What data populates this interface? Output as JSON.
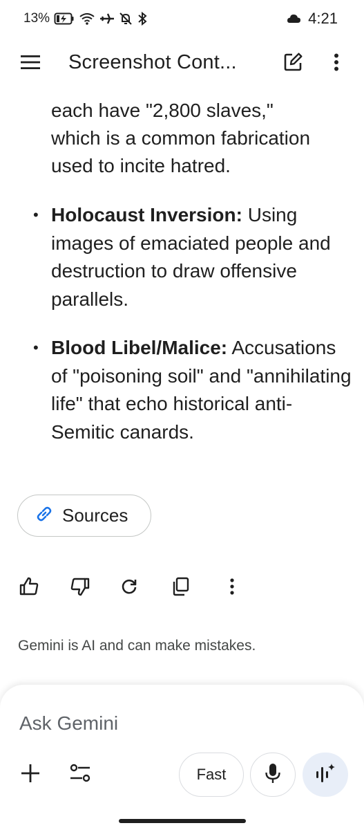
{
  "status_bar": {
    "battery_percent": "13%",
    "time": "4:21",
    "icons": [
      "battery-charging-icon",
      "wifi-icon",
      "airplane-icon",
      "notifications-off-icon",
      "bluetooth-icon",
      "cloud-icon"
    ]
  },
  "app_bar": {
    "title": "Screenshot Cont...",
    "icons": [
      "menu-icon",
      "edit-icon",
      "more-vert-icon"
    ]
  },
  "content": {
    "intro_lines": [
      "each have \"2,800 slaves,\"",
      "which is a common fabrication",
      "used to incite hatred."
    ],
    "bullets": [
      {
        "bold": "Holocaust Inversion:",
        "text": " Using images of emaciated people and destruction to draw offensive parallels."
      },
      {
        "bold": "Blood Libel/Malice:",
        "text": " Accusations of \"poisoning soil\" and \"annihilating life\" that echo historical anti-Semitic canards."
      }
    ]
  },
  "sources": {
    "label": "Sources",
    "icon": "link-icon"
  },
  "actions": [
    "thumbs-up-icon",
    "thumbs-down-icon",
    "regenerate-icon",
    "copy-icon",
    "more-vert-icon"
  ],
  "disclaimer": "Gemini is AI and can make mistakes.",
  "input": {
    "placeholder": "Ask Gemini",
    "mode_label": "Fast",
    "icons": [
      "plus-icon",
      "tools-icon",
      "mic-icon",
      "live-icon"
    ]
  },
  "colors": {
    "text": "#1f1f1f",
    "link_icon": "#1a73e8",
    "live_bg": "#e8eef8"
  }
}
